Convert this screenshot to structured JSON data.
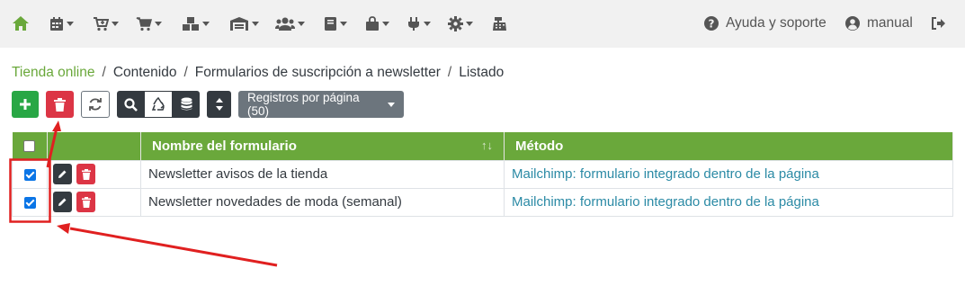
{
  "colors": {
    "brand_green": "#6aa83b",
    "danger": "#dc3545",
    "success": "#28a745",
    "dark": "#343a40",
    "secondary": "#6c757d",
    "link": "#2b8aa5",
    "annotation": "#e02020"
  },
  "topbar": {
    "icons": [
      "home-icon",
      "calendar-icon",
      "cart-plus-icon",
      "cart-icon",
      "boxes-icon",
      "warehouse-icon",
      "users-icon",
      "book-icon",
      "shopping-bag-icon",
      "plug-icon",
      "gear-icon",
      "cash-register-icon"
    ],
    "help_label": "Ayuda y soporte",
    "user_label": "manual"
  },
  "breadcrumb": [
    "Tienda online",
    "Contenido",
    "Formularios de suscripción a newsletter",
    "Listado"
  ],
  "toolbar": {
    "per_page_label": "Registros por página (50)",
    "buttons": [
      "add-button",
      "delete-button",
      "refresh-button",
      "search-button",
      "recycle-button",
      "database-button",
      "sort-button"
    ]
  },
  "table": {
    "columns": [
      "Nombre del formulario",
      "Método"
    ],
    "rows": [
      {
        "checked": true,
        "name": "Newsletter avisos de la tienda",
        "method": "Mailchimp: formulario integrado dentro de la página"
      },
      {
        "checked": true,
        "name": "Newsletter novedades de moda (semanal)",
        "method": "Mailchimp: formulario integrado dentro de la página"
      }
    ]
  }
}
